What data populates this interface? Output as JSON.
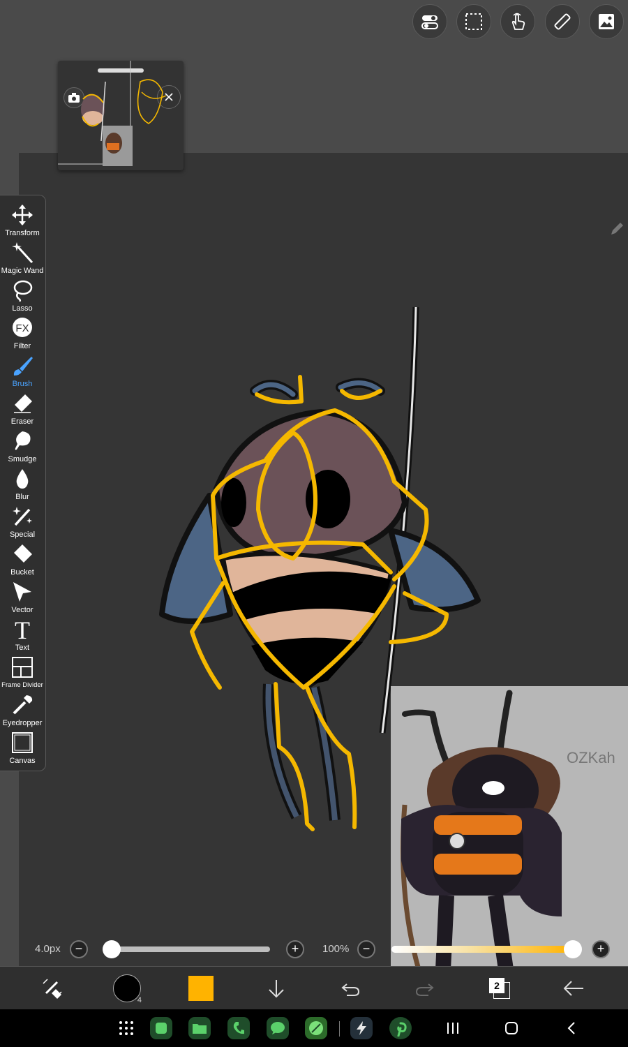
{
  "tools": [
    {
      "label": "Transform",
      "icon": "transform-icon"
    },
    {
      "label": "Magic Wand",
      "icon": "magic-wand-icon"
    },
    {
      "label": "Lasso",
      "icon": "lasso-icon"
    },
    {
      "label": "Filter",
      "icon": "filter-icon"
    },
    {
      "label": "Brush",
      "icon": "brush-icon",
      "active": true
    },
    {
      "label": "Eraser",
      "icon": "eraser-icon"
    },
    {
      "label": "Smudge",
      "icon": "smudge-icon"
    },
    {
      "label": "Blur",
      "icon": "blur-icon"
    },
    {
      "label": "Special",
      "icon": "special-icon"
    },
    {
      "label": "Bucket",
      "icon": "bucket-icon"
    },
    {
      "label": "Vector",
      "icon": "vector-icon"
    },
    {
      "label": "Text",
      "icon": "text-icon"
    },
    {
      "label": "Frame Divider",
      "icon": "frame-divider-icon"
    },
    {
      "label": "Eyedropper",
      "icon": "eyedropper-icon"
    },
    {
      "label": "Canvas",
      "icon": "canvas-icon"
    }
  ],
  "filter_glyph": "FX",
  "text_glyph": "T",
  "sliders": {
    "brush_size_label": "4.0px",
    "brush_size_value": 0.0,
    "opacity_label": "100%",
    "opacity_value": 1.0,
    "minus": "−",
    "plus": "+"
  },
  "bottom_bar": {
    "brush_size_badge": "4",
    "layer_count": "2",
    "current_color": "#ffb300"
  },
  "reference": {
    "signature_text": "OZKah"
  },
  "colors": {
    "accent_blue": "#4aa3ff",
    "sketch_orange": "#f5b800",
    "canvas_bg": "#353535"
  }
}
